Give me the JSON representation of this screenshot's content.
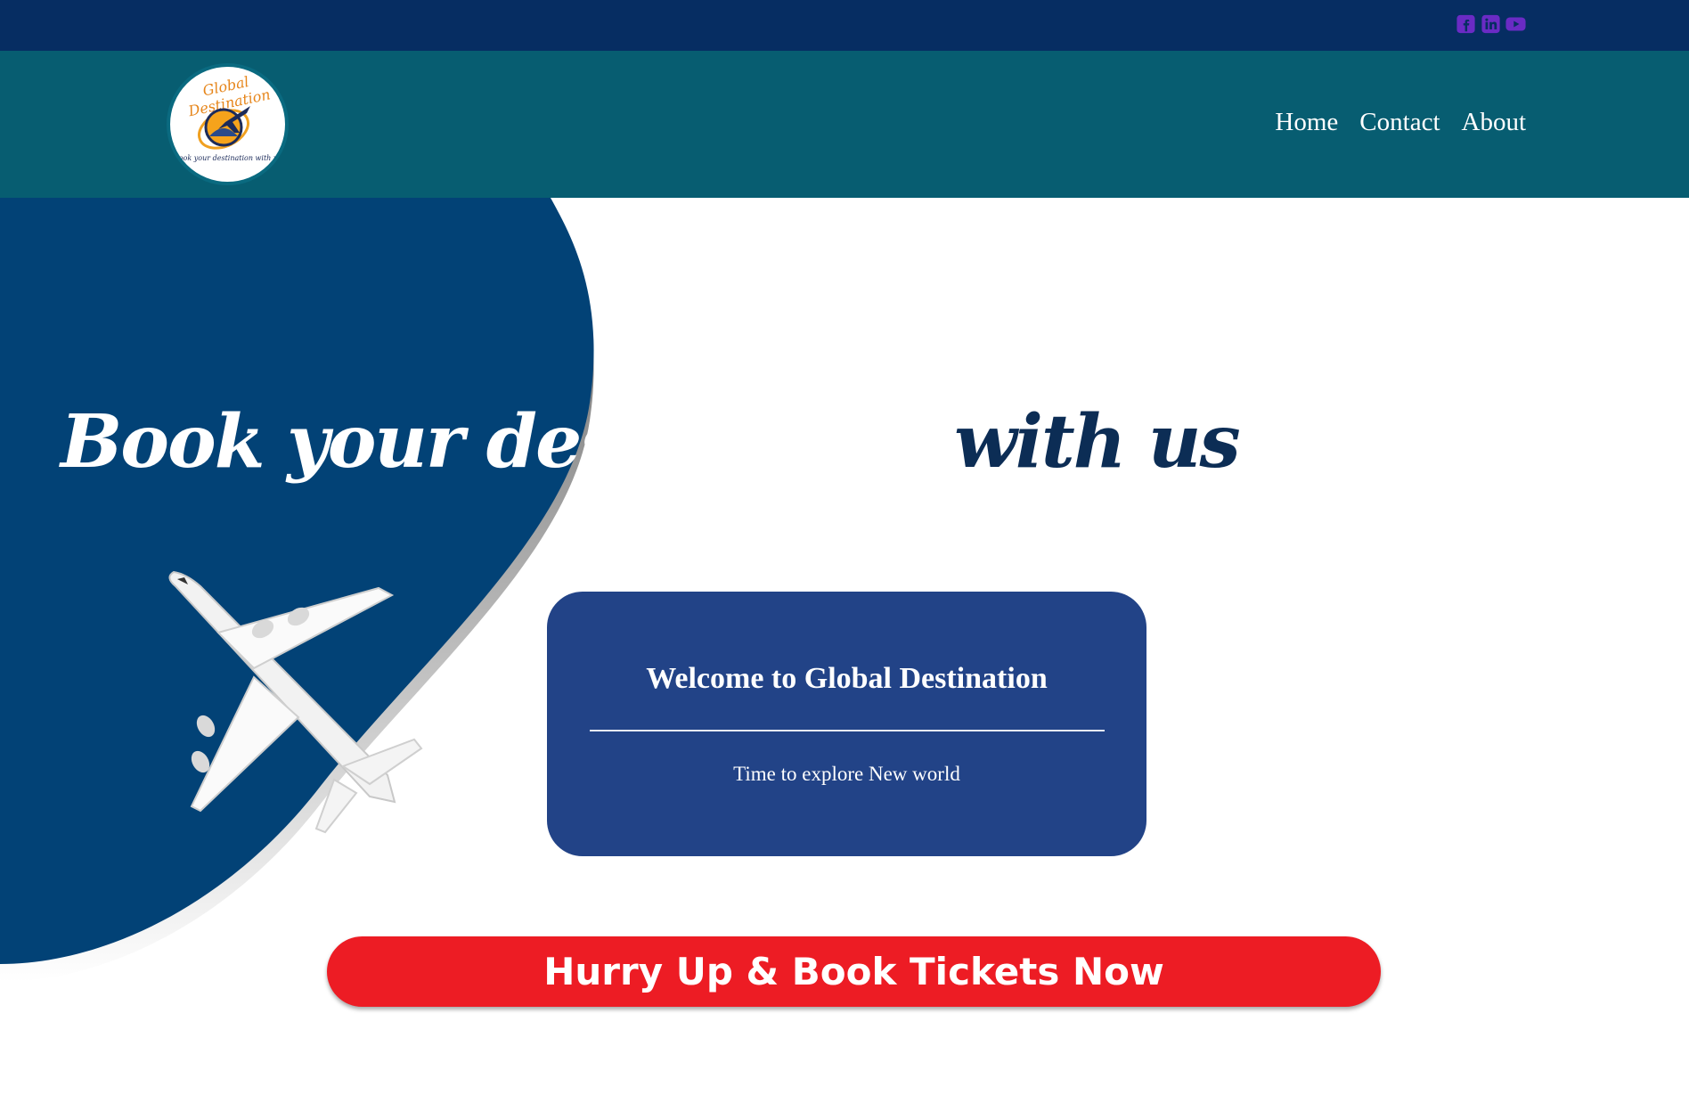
{
  "topbar": {
    "social_icons": [
      "facebook-icon",
      "linkedin-icon",
      "youtube-icon"
    ],
    "icon_color": "#6a2bc4"
  },
  "navbar": {
    "logo": {
      "brand_text": "Global Destination",
      "tagline": "Book your destination with us"
    },
    "links": [
      {
        "label": "Home"
      },
      {
        "label": "Contact"
      },
      {
        "label": "About"
      }
    ]
  },
  "hero": {
    "headline_part1": "Book your destination",
    "headline_part2": " with us",
    "welcome_title": "Welcome to Global Destination",
    "welcome_subtitle": "Time to explore New world",
    "cta_label": "Hurry Up & Book Tickets Now"
  },
  "colors": {
    "topbar": "#062d62",
    "navbar": "#075d71",
    "hero_blue": "#024276",
    "welcome_box": "#224387",
    "cta_red": "#ed1c24"
  }
}
